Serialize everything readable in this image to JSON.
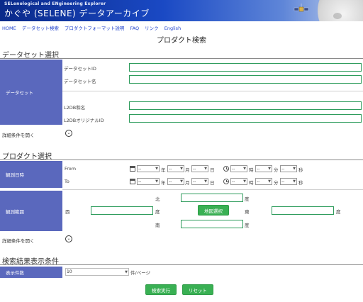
{
  "banner": {
    "subtitle": "SELenological and ENgineering Explorer",
    "title": "かぐや (SELENE) データアーカイブ"
  },
  "nav": [
    "HOME",
    "データセット検索",
    "プロダクトフォーマット説明",
    "FAQ",
    "リンク",
    "English"
  ],
  "page_title": "プロダクト検索",
  "dataset_section": {
    "heading": "データセット選択",
    "label": "データセット",
    "fields": [
      {
        "label": "データセットID",
        "value": ""
      },
      {
        "label": "データセット名",
        "value": ""
      },
      {
        "label": "L2DB和名",
        "value": ""
      },
      {
        "label": "L2DBオリジナルID",
        "value": ""
      }
    ],
    "advanced_toggle": "詳細条件を開く",
    "toggle_icon": "chevron-down-icon"
  },
  "product_section": {
    "heading": "プロダクト選択",
    "time": {
      "label": "観測日時",
      "rows": [
        {
          "label": "From",
          "year": "--",
          "month": "--",
          "day": "--",
          "hour": "--",
          "minute": "--",
          "second": "--"
        },
        {
          "label": "To",
          "year": "--",
          "month": "--",
          "day": "--",
          "hour": "--",
          "minute": "--",
          "second": "--"
        }
      ],
      "units": {
        "year": "年",
        "month": "月",
        "day": "日",
        "hour": "時",
        "minute": "分",
        "second": "秒"
      }
    },
    "range": {
      "label": "観測範囲",
      "north": "北",
      "south": "南",
      "west": "西",
      "east": "東",
      "degree": "度",
      "map_button": "地図選択"
    },
    "advanced_toggle": "詳細条件を開く"
  },
  "display_section": {
    "heading": "検索結果表示条件",
    "label": "表示件数",
    "per_page_value": "10",
    "per_page_unit": "件/ページ"
  },
  "actions": {
    "search": "検索実行",
    "reset": "リセット"
  },
  "colors": {
    "label_bg": "#5a68bd",
    "button_bg": "#39b053",
    "input_border": "#2e9c5c",
    "link": "#2244cc"
  }
}
